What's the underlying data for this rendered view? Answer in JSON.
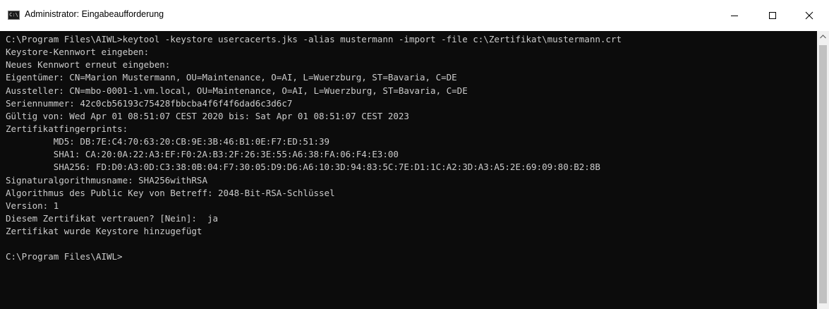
{
  "window": {
    "title": "Administrator: Eingabeaufforderung",
    "icon": "cmd-app-icon",
    "icon_glyph": "C:\\"
  },
  "controls": {
    "minimize_icon": "minimize-icon",
    "maximize_icon": "maximize-icon",
    "close_icon": "close-icon"
  },
  "console": {
    "background": "#0c0c0c",
    "foreground": "#cccccc",
    "lines": [
      "C:\\Program Files\\AIWL>keytool -keystore usercacerts.jks -alias mustermann -import -file c:\\Zertifikat\\mustermann.crt",
      "Keystore-Kennwort eingeben:",
      "Neues Kennwort erneut eingeben:",
      "Eigentümer: CN=Marion Mustermann, OU=Maintenance, O=AI, L=Wuerzburg, ST=Bavaria, C=DE",
      "Aussteller: CN=mbo-0001-1.vm.local, OU=Maintenance, O=AI, L=Wuerzburg, ST=Bavaria, C=DE",
      "Seriennummer: 42c0cb56193c75428fbbcba4f6f4f6dad6c3d6c7",
      "Gültig von: Wed Apr 01 08:51:07 CEST 2020 bis: Sat Apr 01 08:51:07 CEST 2023",
      "Zertifikatfingerprints:",
      "         MD5: DB:7E:C4:70:63:20:CB:9E:3B:46:B1:0E:F7:ED:51:39",
      "         SHA1: CA:20:0A:22:A3:EF:F0:2A:B3:2F:26:3E:55:A6:38:FA:06:F4:E3:00",
      "         SHA256: FD:D0:A3:0D:C3:38:0B:04:F7:30:05:D9:D6:A6:10:3D:94:83:5C:7E:D1:1C:A2:3D:A3:A5:2E:69:09:80:B2:8B",
      "Signaturalgorithmusname: SHA256withRSA",
      "Algorithmus des Public Key von Betreff: 2048-Bit-RSA-Schlüssel",
      "Version: 1",
      "Diesem Zertifikat vertrauen? [Nein]:  ja",
      "Zertifikat wurde Keystore hinzugefügt",
      "",
      "C:\\Program Files\\AIWL>"
    ]
  },
  "scrollbar": {
    "up_icon": "scroll-up-arrow-icon"
  }
}
